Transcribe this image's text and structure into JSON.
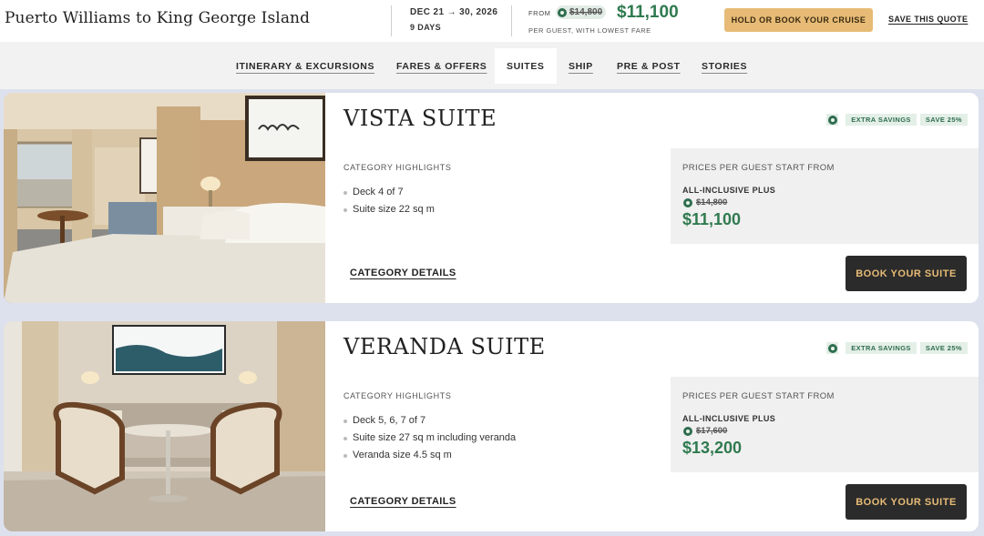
{
  "header": {
    "trip_title": "Puerto Williams to King George Island",
    "dates": "DEC 21 → 30, 2026",
    "duration": "9 DAYS",
    "from_label": "FROM",
    "original_price": "$14,800",
    "price": "$11,100",
    "per_guest_note": "PER GUEST, WITH LOWEST FARE",
    "hold_button": "HOLD OR BOOK YOUR CRUISE",
    "save_quote": "SAVE THIS QUOTE"
  },
  "nav": {
    "tabs": [
      {
        "label": "ITINERARY & EXCURSIONS",
        "active": false
      },
      {
        "label": "FARES & OFFERS",
        "active": false
      },
      {
        "label": "SUITES",
        "active": true
      },
      {
        "label": "SHIP",
        "active": false
      },
      {
        "label": "PRE & POST",
        "active": false
      },
      {
        "label": "STORIES",
        "active": false
      }
    ]
  },
  "suites": [
    {
      "name": "VISTA SUITE",
      "badges": [
        "EXTRA SAVINGS",
        "SAVE 25%"
      ],
      "highlights_title": "CATEGORY HIGHLIGHTS",
      "highlights": [
        "Deck 4 of 7",
        "Suite size 22 sq m"
      ],
      "category_details": "CATEGORY DETAILS",
      "price_label": "PRICES PER GUEST START FROM",
      "fare_tier": "ALL-INCLUSIVE PLUS",
      "original_price": "$14,800",
      "price": "$11,100",
      "book_button": "BOOK YOUR SUITE"
    },
    {
      "name": "VERANDA SUITE",
      "badges": [
        "EXTRA SAVINGS",
        "SAVE 25%"
      ],
      "highlights_title": "CATEGORY HIGHLIGHTS",
      "highlights": [
        "Deck 5, 6, 7 of 7",
        "Suite size 27 sq m including veranda",
        "Veranda size 4.5 sq m"
      ],
      "category_details": "CATEGORY DETAILS",
      "price_label": "PRICES PER GUEST START FROM",
      "fare_tier": "ALL-INCLUSIVE PLUS",
      "original_price": "$17,600",
      "price": "$13,200",
      "book_button": "BOOK YOUR SUITE"
    }
  ],
  "colors": {
    "accent_gold": "#e7bb76",
    "price_green": "#2f7a4f",
    "dark_button": "#2b2b2b",
    "page_background": "#dde1ee"
  }
}
